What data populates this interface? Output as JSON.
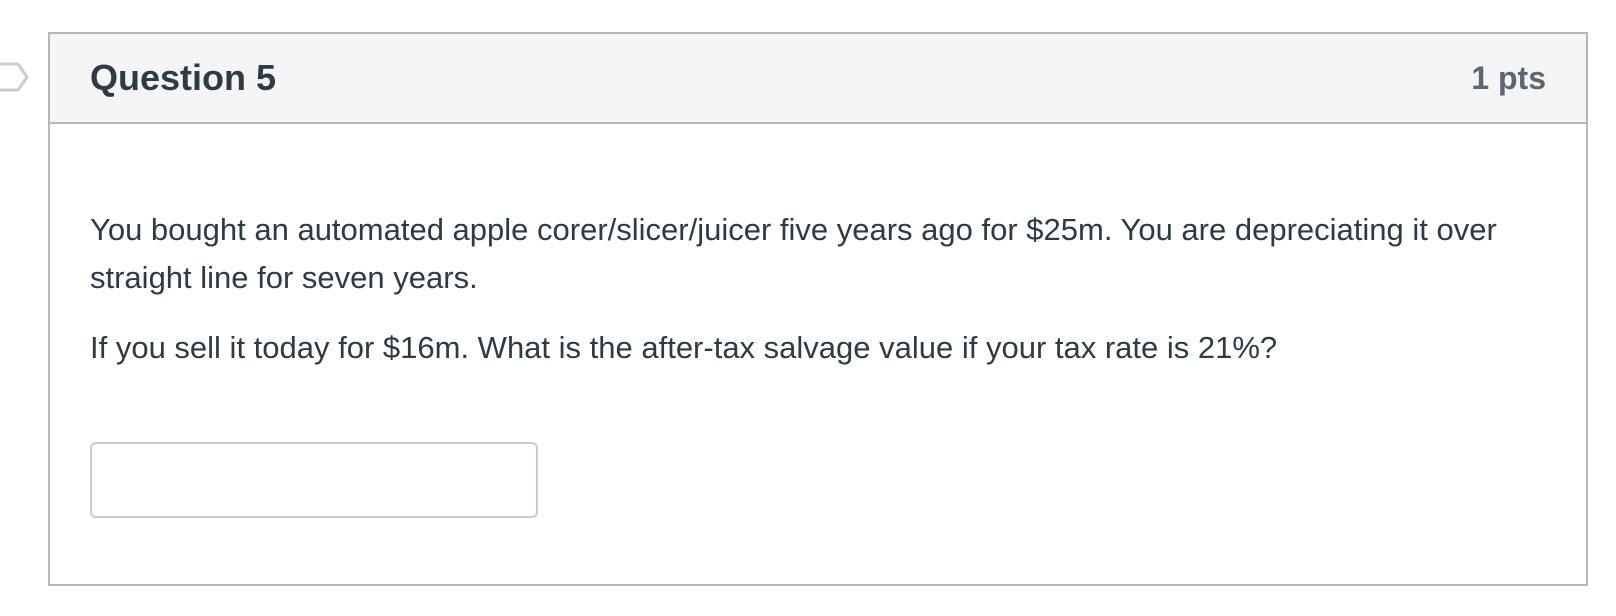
{
  "question": {
    "title": "Question 5",
    "points": "1 pts",
    "paragraphs": [
      "You bought an automated apple corer/slicer/juicer five years ago for $25m. You are depreciating it over straight line for seven years.",
      "If you sell it today for $16m. What is the after-tax salvage value if your tax rate is 21%?"
    ],
    "answer": {
      "value": "",
      "placeholder": ""
    }
  },
  "icons": {
    "flag": "flag-marker-icon"
  },
  "colors": {
    "header_bg": "#f5f5f5",
    "border": "#b7b7b7",
    "text": "#2d3b45",
    "points_text": "#5b6770",
    "flag_outline": "#c7cdd1"
  }
}
